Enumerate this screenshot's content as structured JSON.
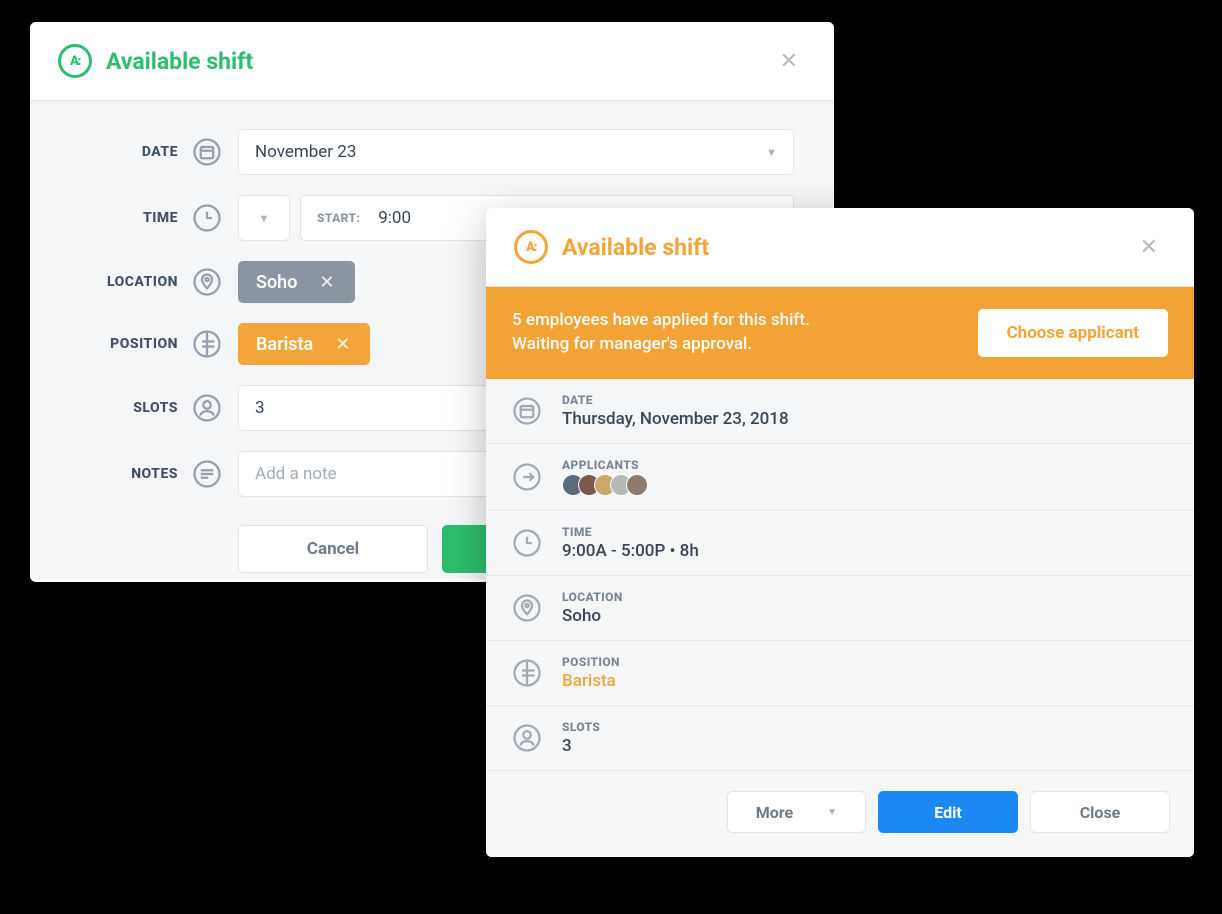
{
  "modal_a": {
    "title": "Available shift",
    "rows": {
      "date": {
        "label": "DATE",
        "value": "November 23"
      },
      "time": {
        "label": "TIME",
        "start_prefix": "START:",
        "start_value": "9:00"
      },
      "location": {
        "label": "LOCATION",
        "chip": "Soho"
      },
      "position": {
        "label": "POSITION",
        "chip": "Barista"
      },
      "slots": {
        "label": "SLOTS",
        "value": "3"
      },
      "notes": {
        "label": "NOTES",
        "placeholder": "Add a note"
      }
    },
    "cancel": "Cancel"
  },
  "modal_b": {
    "title": "Available shift",
    "banner": {
      "line1": "5 employees have applied for this shift.",
      "line2": "Waiting for manager's approval.",
      "cta": "Choose applicant"
    },
    "details": {
      "date": {
        "label": "DATE",
        "value": "Thursday, November 23, 2018"
      },
      "applicants": {
        "label": "APPLICANTS",
        "count": 5
      },
      "time": {
        "label": "TIME",
        "value": "9:00A - 5:00P • 8h"
      },
      "location": {
        "label": "LOCATION",
        "value": "Soho"
      },
      "position": {
        "label": "POSITION",
        "value": "Barista"
      },
      "slots": {
        "label": "SLOTS",
        "value": "3"
      }
    },
    "footer": {
      "more": "More",
      "edit": "Edit",
      "close": "Close"
    }
  },
  "avatar_colors": [
    "#5a6b7a",
    "#7a5a4a",
    "#c9a86a",
    "#b8b8b8",
    "#8f7a6f"
  ]
}
